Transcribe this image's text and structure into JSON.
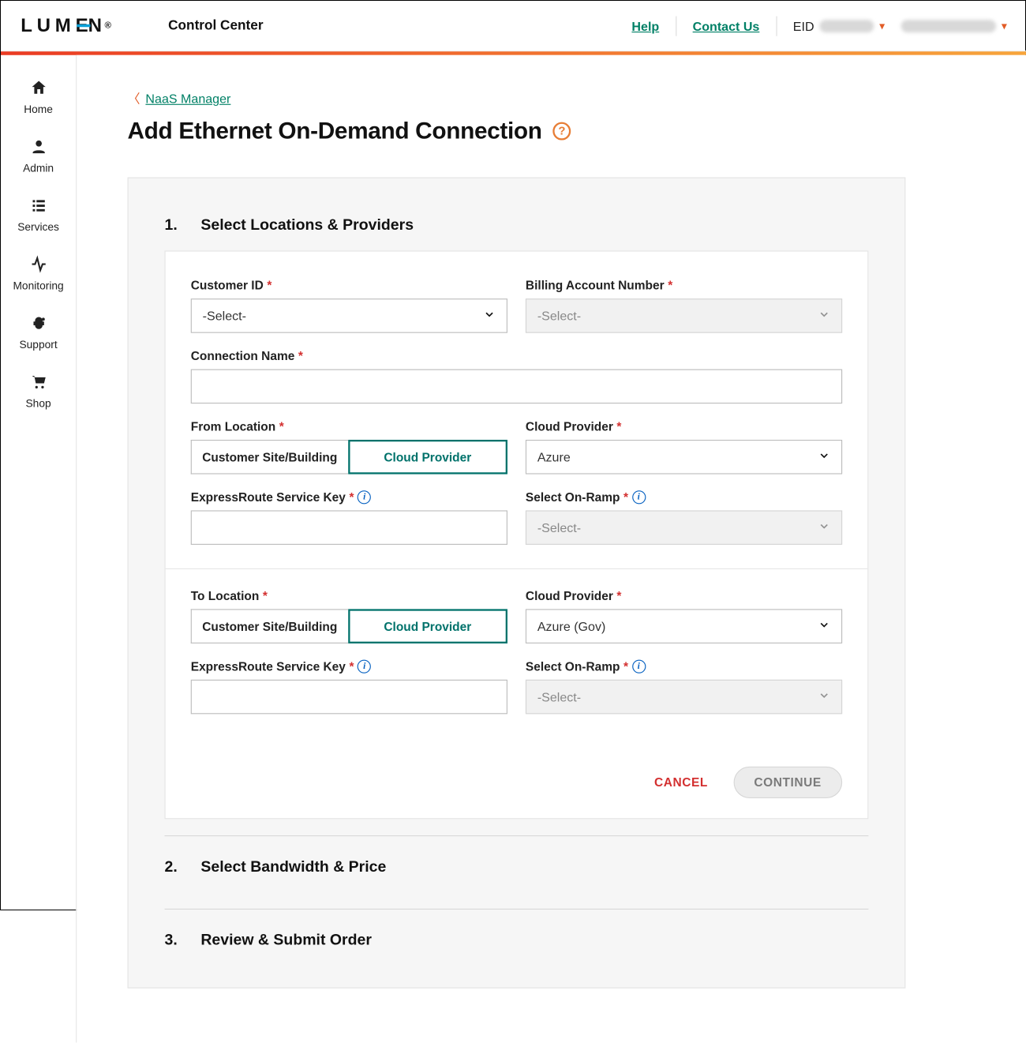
{
  "header": {
    "brand": "LUMEN",
    "app_title": "Control Center",
    "help": "Help",
    "contact": "Contact Us",
    "eid_label": "EID"
  },
  "sidenav": {
    "home": "Home",
    "admin": "Admin",
    "services": "Services",
    "monitoring": "Monitoring",
    "support": "Support",
    "shop": "Shop"
  },
  "breadcrumb": {
    "back": "NaaS Manager"
  },
  "page": {
    "title": "Add Ethernet On-Demand Connection"
  },
  "wizard": {
    "step1": {
      "num": "1.",
      "title": "Select Locations & Providers"
    },
    "step2": {
      "num": "2.",
      "title": "Select Bandwidth & Price"
    },
    "step3": {
      "num": "3.",
      "title": "Review & Submit Order"
    }
  },
  "form": {
    "customer_id": {
      "label": "Customer ID",
      "value": "-Select-"
    },
    "ban": {
      "label": "Billing Account Number",
      "value": "-Select-"
    },
    "conn_name": {
      "label": "Connection Name",
      "value": ""
    },
    "from_loc": {
      "label": "From Location",
      "opt_site": "Customer Site/Building",
      "opt_cloud": "Cloud Provider"
    },
    "from_provider": {
      "label": "Cloud Provider",
      "value": "Azure"
    },
    "from_key": {
      "label": "ExpressRoute Service Key",
      "value": ""
    },
    "from_onramp": {
      "label": "Select On-Ramp",
      "value": "-Select-"
    },
    "to_loc": {
      "label": "To Location",
      "opt_site": "Customer Site/Building",
      "opt_cloud": "Cloud Provider"
    },
    "to_provider": {
      "label": "Cloud Provider",
      "value": "Azure (Gov)"
    },
    "to_key": {
      "label": "ExpressRoute Service Key",
      "value": ""
    },
    "to_onramp": {
      "label": "Select On-Ramp",
      "value": "-Select-"
    },
    "cancel": "CANCEL",
    "continue": "CONTINUE"
  }
}
